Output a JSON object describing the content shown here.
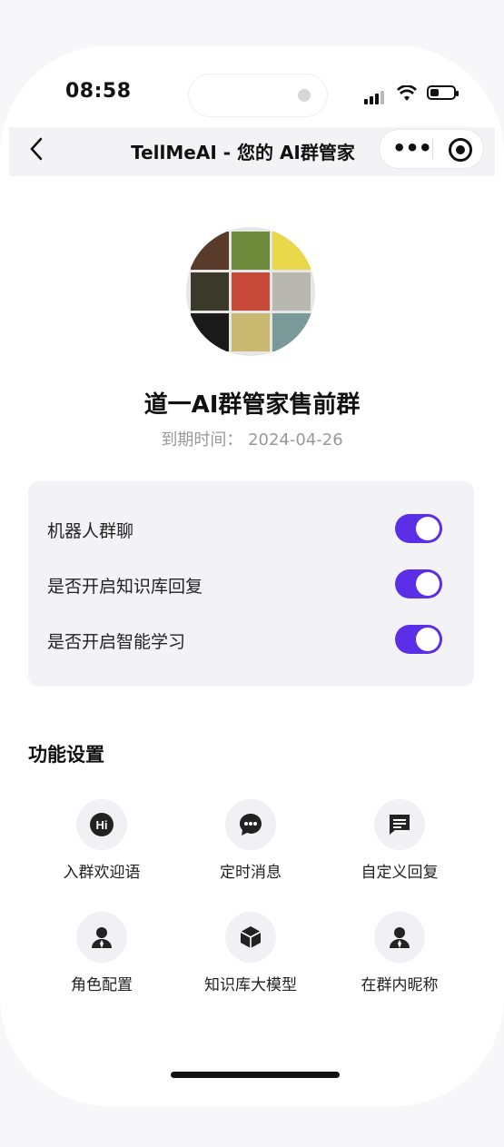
{
  "status_bar": {
    "time": "08:58"
  },
  "nav": {
    "title": "TellMeAI - 您的 AI群管家"
  },
  "group": {
    "name": "道一AI群管家售前群",
    "expire_label": "到期时间：",
    "expire_date": "2024-04-26"
  },
  "settings": [
    {
      "label": "机器人群聊",
      "enabled": true
    },
    {
      "label": "是否开启知识库回复",
      "enabled": true
    },
    {
      "label": "是否开启智能学习",
      "enabled": true
    }
  ],
  "features": {
    "title": "功能设置",
    "items": [
      {
        "label": "入群欢迎语",
        "icon": "hi-icon"
      },
      {
        "label": "定时消息",
        "icon": "chat-icon"
      },
      {
        "label": "自定义回复",
        "icon": "message-icon"
      },
      {
        "label": "角色配置",
        "icon": "user-icon"
      },
      {
        "label": "知识库大模型",
        "icon": "cube-icon"
      },
      {
        "label": "在群内昵称",
        "icon": "user-icon"
      }
    ]
  },
  "colors": {
    "accent": "#5b2ee8"
  }
}
